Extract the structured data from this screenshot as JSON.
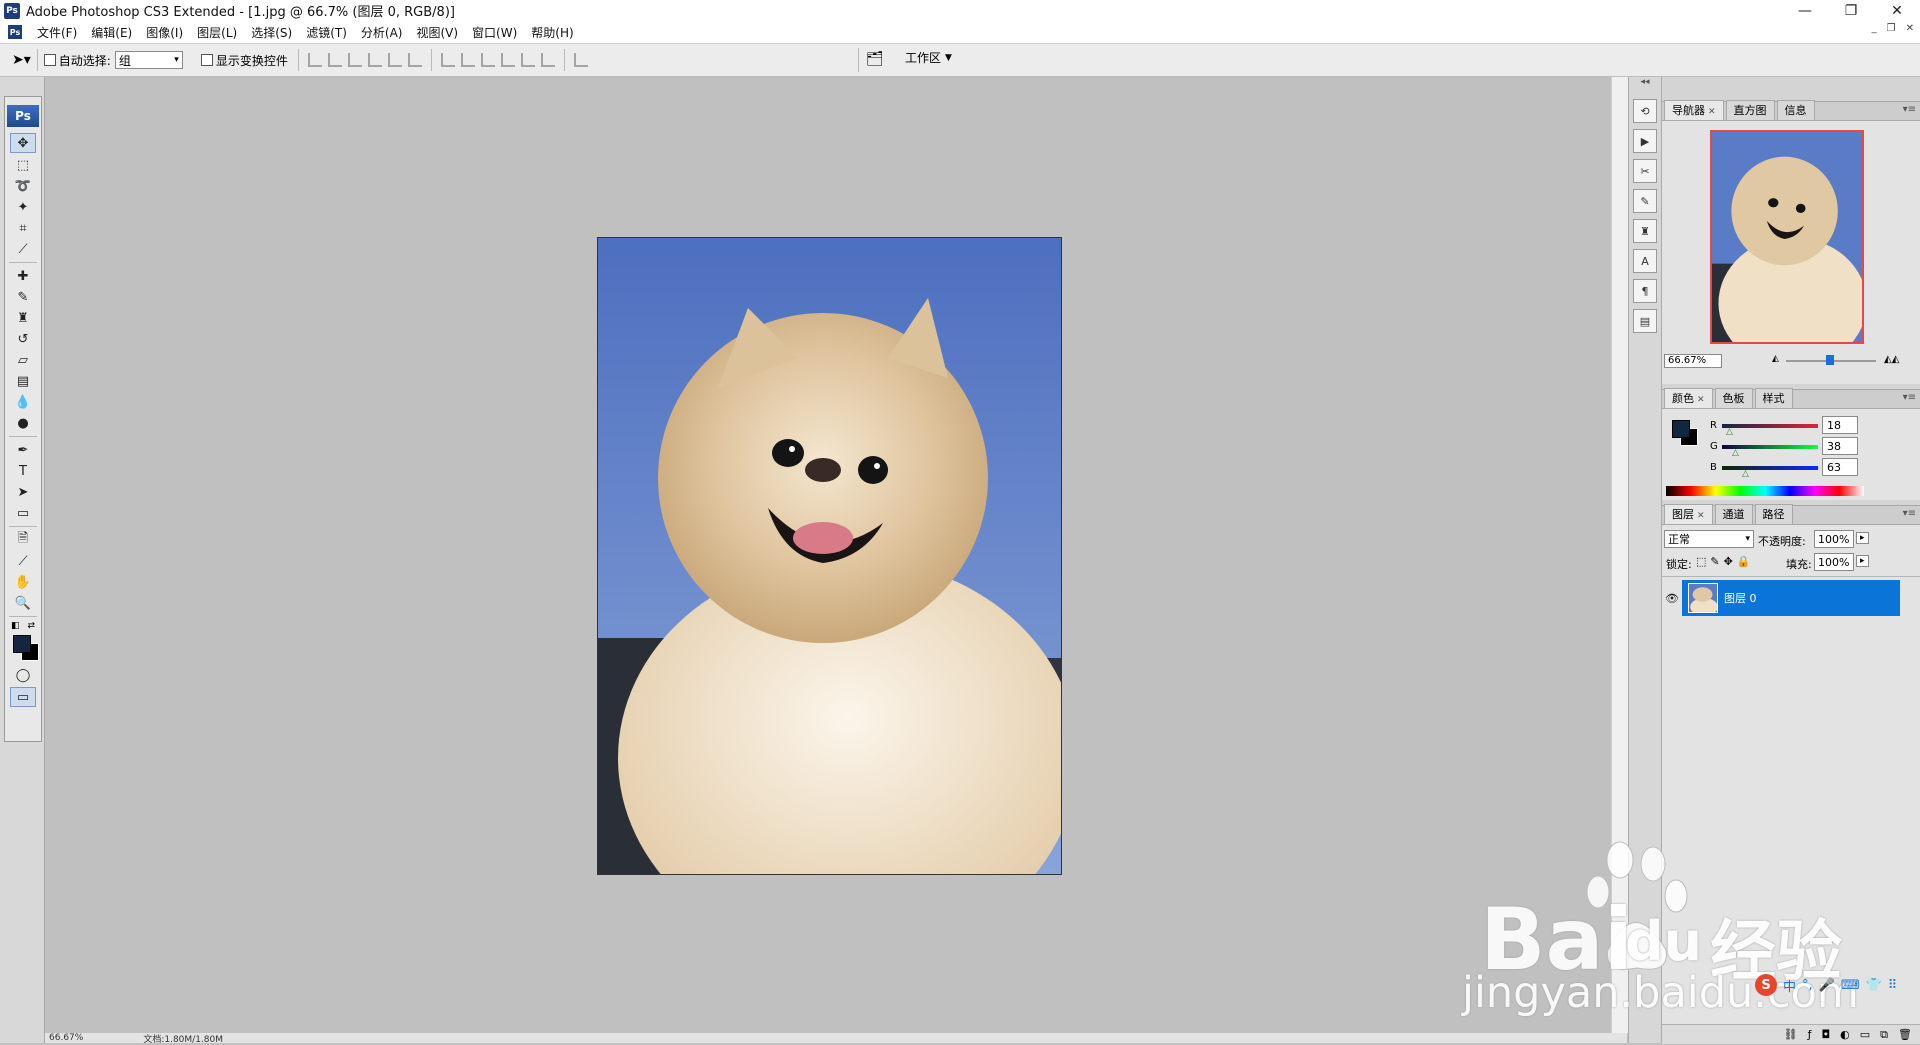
{
  "window": {
    "title": "Adobe Photoshop CS3 Extended - [1.jpg @ 66.7% (图层 0, RGB/8)]",
    "app_icon": "Ps",
    "buttons": [
      "—",
      "❐",
      "✕"
    ]
  },
  "menubar": {
    "items": [
      "文件(F)",
      "编辑(E)",
      "图像(I)",
      "图层(L)",
      "选择(S)",
      "滤镜(T)",
      "分析(A)",
      "视图(V)",
      "窗口(W)",
      "帮助(H)"
    ],
    "doc_buttons": [
      "_",
      "❐",
      "✕"
    ]
  },
  "options": {
    "auto_select_label": "自动选择:",
    "auto_select_value": "组",
    "show_transform_label": "显示变换控件",
    "workspace_label": "工作区"
  },
  "toolbox": {
    "logo": "Ps"
  },
  "status": {
    "zoom": "66.67%",
    "doc": "文档:1.80M/1.80M"
  },
  "navigator": {
    "tabs": [
      "导航器",
      "直方图",
      "信息"
    ],
    "zoom": "66.67%"
  },
  "color": {
    "tabs": [
      "颜色",
      "色板",
      "样式"
    ],
    "r_label": "R",
    "g_label": "G",
    "b_label": "B",
    "r": "18",
    "g": "38",
    "b": "63",
    "fg_hex": "#12263f"
  },
  "layers": {
    "tabs": [
      "图层",
      "通道",
      "路径"
    ],
    "blend_mode": "正常",
    "opacity_label": "不透明度:",
    "opacity": "100%",
    "lock_label": "锁定:",
    "fill_label": "填充:",
    "fill": "100%",
    "layer_name": "图层 0",
    "selection_color": "#0a74d8"
  },
  "watermark": {
    "brand": "Bai",
    "brand2": "du",
    "cn": "经验",
    "url": "jingyan.baidu.com"
  }
}
